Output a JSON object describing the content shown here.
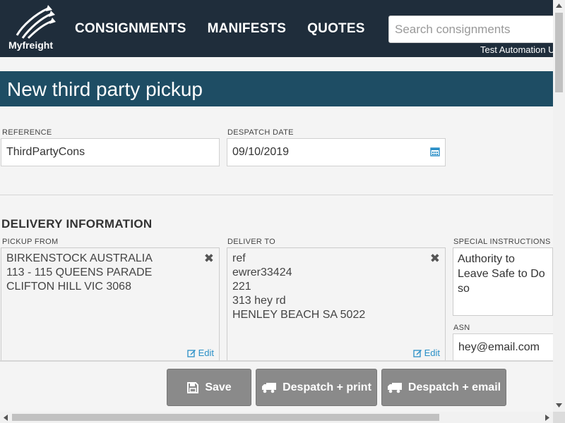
{
  "header": {
    "logo_text": "Myfreight",
    "nav": [
      "CONSIGNMENTS",
      "MANIFESTS",
      "QUOTES"
    ],
    "search_placeholder": "Search consignments",
    "user": "Test Automation U"
  },
  "page": {
    "title": "New third party pickup"
  },
  "form": {
    "reference_label": "REFERENCE",
    "reference_value": "ThirdPartyCons",
    "despatch_label": "DESPATCH DATE",
    "despatch_value": "09/10/2019"
  },
  "delivery": {
    "section_title": "DELIVERY INFORMATION",
    "pickup_label": "PICKUP FROM",
    "pickup_lines": [
      "BIRKENSTOCK AUSTRALIA",
      "113 - 115 QUEENS PARADE",
      "CLIFTON HILL VIC 3068"
    ],
    "deliver_label": "DELIVER TO",
    "deliver_lines": [
      "ref",
      "ewrer33424",
      "221",
      "313 hey rd",
      "HENLEY BEACH SA 5022"
    ],
    "edit_label": "Edit",
    "special_label": "SPECIAL INSTRUCTIONS",
    "special_value": "Authority to Leave Safe to Do so",
    "asn_label": "ASN",
    "asn_value": "hey@email.com"
  },
  "actions": {
    "save": "Save",
    "despatch_print": "Despatch + print",
    "despatch_email": "Despatch + email"
  },
  "colors": {
    "header_bg": "#1f2d3b",
    "title_bg": "#1e4d64",
    "link": "#2a8fc7",
    "button_bg": "#8a8a8a"
  }
}
